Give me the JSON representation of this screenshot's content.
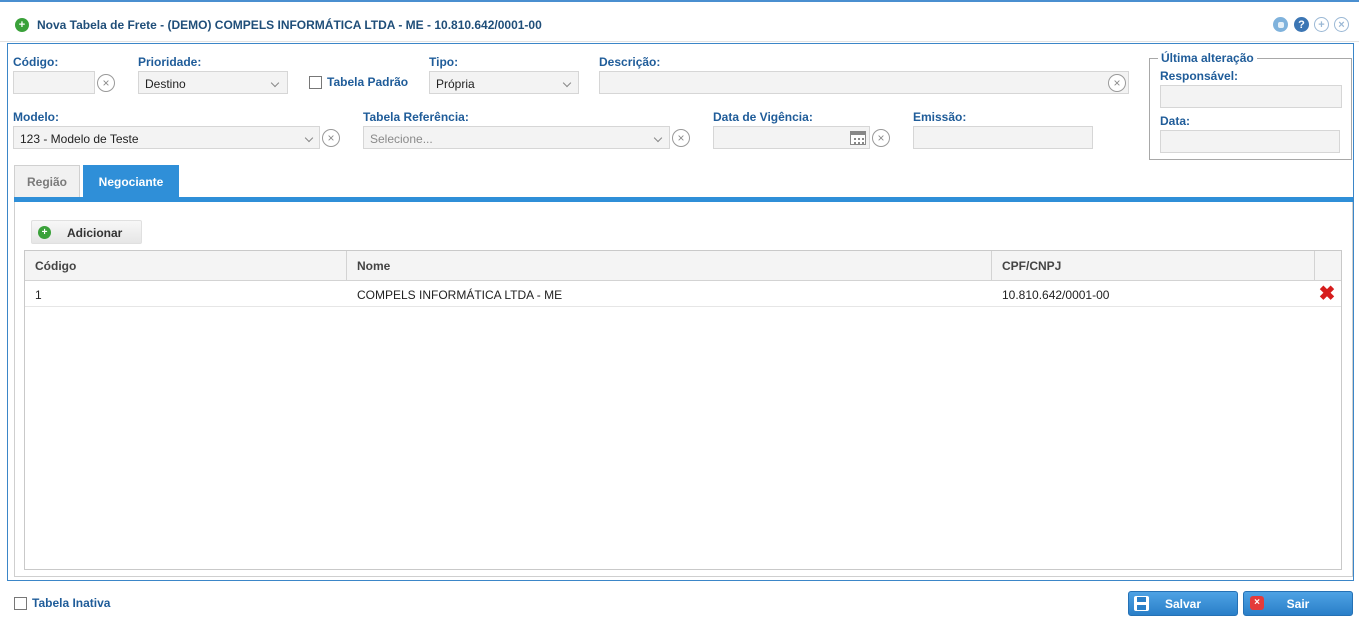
{
  "window": {
    "title": "Nova Tabela de Frete - (DEMO) COMPELS INFORMÁTICA LTDA - ME - 10.810.642/0001-00",
    "help_glyph": "?"
  },
  "form": {
    "codigo": {
      "label": "Código:",
      "value": ""
    },
    "prioridade": {
      "label": "Prioridade:",
      "value": "Destino"
    },
    "tabela_padrao": {
      "label": "Tabela Padrão",
      "checked": false
    },
    "tipo": {
      "label": "Tipo:",
      "value": "Própria"
    },
    "descricao": {
      "label": "Descrição:",
      "value": ""
    },
    "modelo": {
      "label": "Modelo:",
      "value": "123 - Modelo de Teste"
    },
    "tabela_referencia": {
      "label": "Tabela Referência:",
      "placeholder": "Selecione..."
    },
    "data_vigencia": {
      "label": "Data de Vigência:",
      "value": ""
    },
    "emissao": {
      "label": "Emissão:",
      "value": ""
    }
  },
  "ultima_alteracao": {
    "legend": "Última alteração",
    "responsavel_label": "Responsável:",
    "responsavel_value": "",
    "data_label": "Data:",
    "data_value": ""
  },
  "tabs": [
    {
      "label": "Região",
      "active": false
    },
    {
      "label": "Negociante",
      "active": true
    }
  ],
  "negociante": {
    "add_button": "Adicionar",
    "columns": [
      "Código",
      "Nome",
      "CPF/CNPJ"
    ],
    "rows": [
      {
        "codigo": "1",
        "nome": "COMPELS INFORMÁTICA LTDA - ME",
        "cpf_cnpj": "10.810.642/0001-00"
      }
    ]
  },
  "footer": {
    "tabela_inativa": {
      "label": "Tabela Inativa",
      "checked": false
    },
    "salvar": "Salvar",
    "sair": "Sair"
  },
  "colors": {
    "accent": "#2f8fd8",
    "label": "#1f5c99",
    "title": "#1f4e79",
    "delete": "#d61d1d",
    "add": "#3aa13a"
  },
  "icons": {
    "title": "add-circle-icon",
    "minimize": "minimize-icon",
    "help": "help-icon",
    "maximize": "maximize-icon",
    "close": "close-icon",
    "add": "add-circle-icon",
    "delete": "delete-x-icon",
    "save": "floppy-disk-icon",
    "exit": "exit-icon",
    "calendar": "calendar-icon"
  }
}
